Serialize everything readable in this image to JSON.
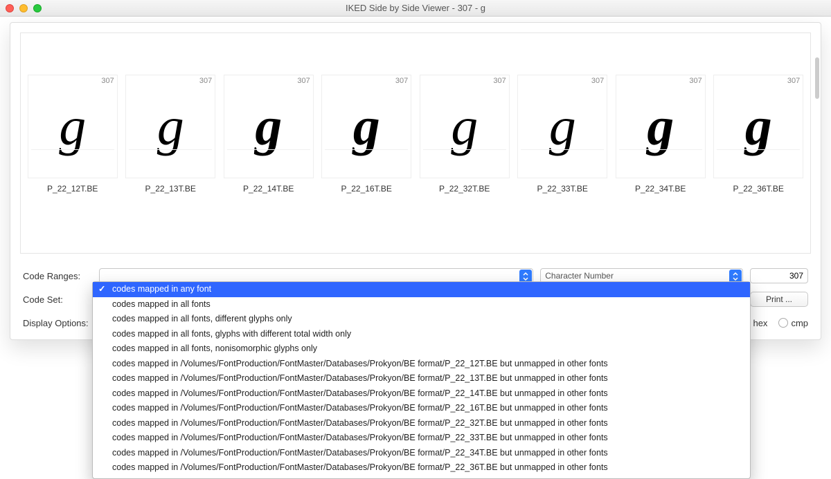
{
  "window": {
    "title": "IKED Side by Side Viewer - 307 - g"
  },
  "glyphs": [
    {
      "num": "307",
      "label": "P_22_12T.BE",
      "weight": 400
    },
    {
      "num": "307",
      "label": "P_22_13T.BE",
      "weight": 500
    },
    {
      "num": "307",
      "label": "P_22_14T.BE",
      "weight": 700
    },
    {
      "num": "307",
      "label": "P_22_16T.BE",
      "weight": 900
    },
    {
      "num": "307",
      "label": "P_22_32T.BE",
      "weight": 300
    },
    {
      "num": "307",
      "label": "P_22_33T.BE",
      "weight": 400
    },
    {
      "num": "307",
      "label": "P_22_34T.BE",
      "weight": 700
    },
    {
      "num": "307",
      "label": "P_22_36T.BE",
      "weight": 900
    }
  ],
  "glyph_char": "g",
  "controls": {
    "code_ranges_label": "Code Ranges:",
    "char_number_label": "Character Number",
    "char_number_value": "307",
    "code_set_label": "Code Set:",
    "print_label": "Print ...",
    "display_options_label": "Display Options:",
    "radio_hex": "hex",
    "radio_cmp": "cmp",
    "colon": ":"
  },
  "dropdown": {
    "items": [
      "codes mapped in any font",
      "codes mapped in all fonts",
      "codes mapped in all fonts, different glyphs only",
      "codes mapped in all fonts, glyphs with different total width only",
      "codes mapped in all fonts, nonisomorphic glyphs only",
      "codes mapped in /Volumes/FontProduction/FontMaster/Databases/Prokyon/BE format/P_22_12T.BE but unmapped in other fonts",
      "codes mapped in /Volumes/FontProduction/FontMaster/Databases/Prokyon/BE format/P_22_13T.BE but unmapped in other fonts",
      "codes mapped in /Volumes/FontProduction/FontMaster/Databases/Prokyon/BE format/P_22_14T.BE but unmapped in other fonts",
      "codes mapped in /Volumes/FontProduction/FontMaster/Databases/Prokyon/BE format/P_22_16T.BE but unmapped in other fonts",
      "codes mapped in /Volumes/FontProduction/FontMaster/Databases/Prokyon/BE format/P_22_32T.BE but unmapped in other fonts",
      "codes mapped in /Volumes/FontProduction/FontMaster/Databases/Prokyon/BE format/P_22_33T.BE but unmapped in other fonts",
      "codes mapped in /Volumes/FontProduction/FontMaster/Databases/Prokyon/BE format/P_22_34T.BE but unmapped in other fonts",
      "codes mapped in /Volumes/FontProduction/FontMaster/Databases/Prokyon/BE format/P_22_36T.BE but unmapped in other fonts"
    ],
    "selected_index": 0
  }
}
